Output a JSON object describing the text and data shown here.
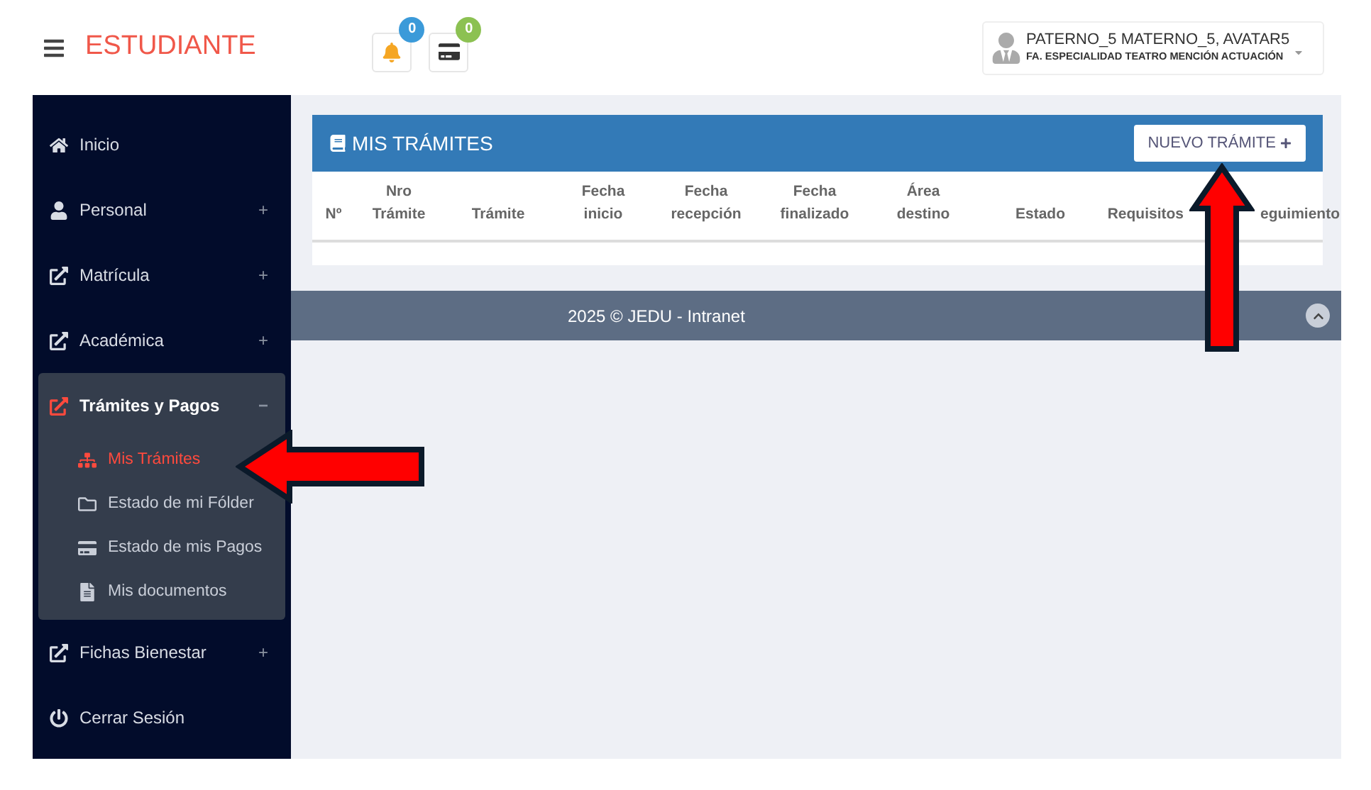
{
  "header": {
    "title": "ESTUDIANTE",
    "notifications": [
      {
        "kind": "bell",
        "count": "0",
        "color": "#3b9ad9"
      },
      {
        "kind": "card",
        "count": "0",
        "color": "#8cc152"
      }
    ],
    "user": {
      "name": "PATERNO_5 MATERNO_5, AVATAR5",
      "program": "FA. ESPECIALIDAD TEATRO MENCIÓN ACTUACIÓN"
    }
  },
  "sidebar": {
    "items": [
      {
        "label": "Inicio"
      },
      {
        "label": "Personal",
        "toggle": "+",
        "expanded": false
      },
      {
        "label": "Matrícula",
        "toggle": "+",
        "expanded": false
      },
      {
        "label": "Académica",
        "toggle": "+",
        "expanded": false
      },
      {
        "label": "Trámites y Pagos",
        "toggle": "−",
        "expanded": true,
        "children": [
          {
            "label": "Mis Trámites",
            "selected": true
          },
          {
            "label": "Estado de mi Fólder",
            "selected": false
          },
          {
            "label": "Estado de mis Pagos",
            "selected": false
          },
          {
            "label": "Mis documentos",
            "selected": false
          }
        ]
      },
      {
        "label": "Fichas Bienestar",
        "toggle": "+",
        "expanded": false
      },
      {
        "label": "Cerrar Sesión"
      }
    ]
  },
  "panel": {
    "title": "MIS TRÁMITES",
    "button": "NUEVO TRÁMITE",
    "columns": [
      "Nº",
      "Nro Trámite",
      "Trámite",
      "Fecha inicio",
      "Fecha recepción",
      "Fecha finalizado",
      "Área destino",
      "Estado",
      "Requisitos",
      "eguimiento"
    ]
  },
  "footer": {
    "text": "2025 © JEDU - Intranet"
  }
}
